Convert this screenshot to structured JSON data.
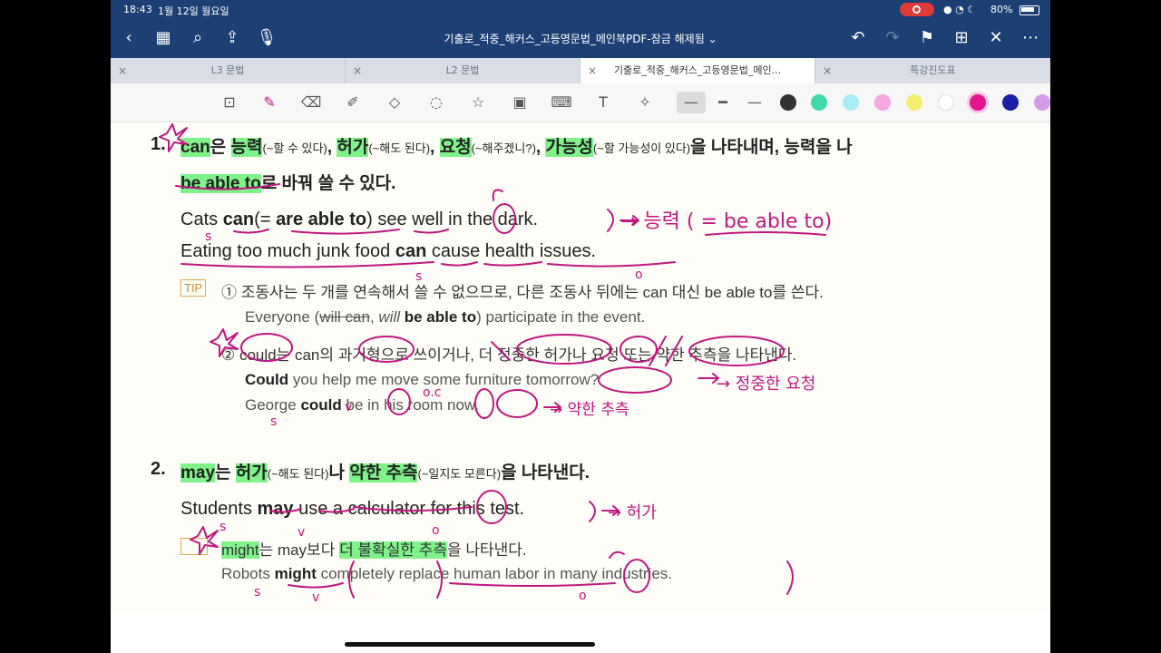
{
  "status": {
    "time": "18:43",
    "date": "1월 12일 월요일",
    "battery": "80%"
  },
  "nav": {
    "title": "기출로_적중_해커스_고등영문법_메인북PDF-잠금 해제됨 ⌄"
  },
  "tabs": [
    {
      "label": "L3 문법",
      "active": false
    },
    {
      "label": "L2 문법",
      "active": false
    },
    {
      "label": "기출로_적중_해커스_고등영문법_메인...",
      "active": true
    },
    {
      "label": "특강진도표",
      "active": false
    }
  ],
  "colors": {
    "navbar": "#1c3f74",
    "highlight": "#7ff28a",
    "ink": "#c0177f",
    "swatches": [
      "#333333",
      "#3fd9a8",
      "#a8ecf7",
      "#f5a8e0",
      "#f2ef6e",
      "#ffffff",
      "#e6148c",
      "#1d1fa8",
      "#d49ce8"
    ]
  },
  "content": {
    "s1_num": "1.",
    "s1_can": "can",
    "s1_eun": "은 ",
    "s1_ability": "능력",
    "s1_ability_note": "(~할 수 있다)",
    "comma": ", ",
    "s1_permission": "허가",
    "s1_permission_note": "(~해도 된다)",
    "s1_request": "요청",
    "s1_request_note": "(~해주겠니?)",
    "s1_possibility": "가능성",
    "s1_possibility_note": "(~할 가능성이 있다)",
    "s1_tail": "을 나타내며, 능력을 나",
    "s1_line2_hl": "be able to",
    "s1_line2_rest": "로 바꿔 쓸 수 있다.",
    "ex1a_1": "Cats ",
    "ex1a_can": "can",
    "ex1a_2": "(= ",
    "ex1a_bat": "are able to",
    "ex1a_3": ") see well in the dark.",
    "ex1b_1": "Eating too much junk food ",
    "ex1b_can": "can",
    "ex1b_2": " cause health issues.",
    "tip_label": "TIP",
    "tip1": "① 조동사는 두 개를 연속해서 쓸 수 없으므로, 다른 조동사 뒤에는 can 대신 be able to를 쓴다.",
    "tip1_ex_1": "Everyone (",
    "tip1_ex_strike": "will can",
    "tip1_ex_2": ", ",
    "tip1_ex_will": "will",
    "tip1_ex_3": " ",
    "tip1_ex_bat": "be able to",
    "tip1_ex_4": ") participate in the event.",
    "tip2": "② could는 can의 과거형으로 쓰이거나, 더 정중한 허가나 요청 또는 약한 추측을 나타낸다.",
    "tip2_ex1_could": "Could",
    "tip2_ex1_rest": " you help me move some furniture tomorrow?",
    "tip2_ex2_1": "George ",
    "tip2_ex2_could": "could",
    "tip2_ex2_rest": " be in his room now.",
    "s2_num": "2.",
    "s2_may": "may",
    "s2_neun": "는 ",
    "s2_permission": "허가",
    "s2_permission_note": "(~해도 된다)",
    "s2_na": "나 ",
    "s2_guess": "약한 추측",
    "s2_guess_note": "(~일지도 모른다)",
    "s2_tail": "을 나타낸다.",
    "ex2_1": "Students ",
    "ex2_may": "may",
    "ex2_2": " use a calculator for this test.",
    "tip3_might": "might",
    "tip3_1": "는 may보다 ",
    "tip3_hl": "더 불확실한 추측",
    "tip3_2": "을 나타낸다.",
    "tip3_ex_1": "Robots ",
    "tip3_ex_might": "might",
    "tip3_ex_2": " completely replace human labor in many industries."
  },
  "handwriting": {
    "n1": "→ 능력 ( = be able to)",
    "n2": "→ 정중한 요청",
    "n3": "→ 약한 추측",
    "n4": "→ 허가",
    "marks_s": "s",
    "marks_v": "v",
    "marks_o": "o",
    "marks_oc": "o.c"
  }
}
